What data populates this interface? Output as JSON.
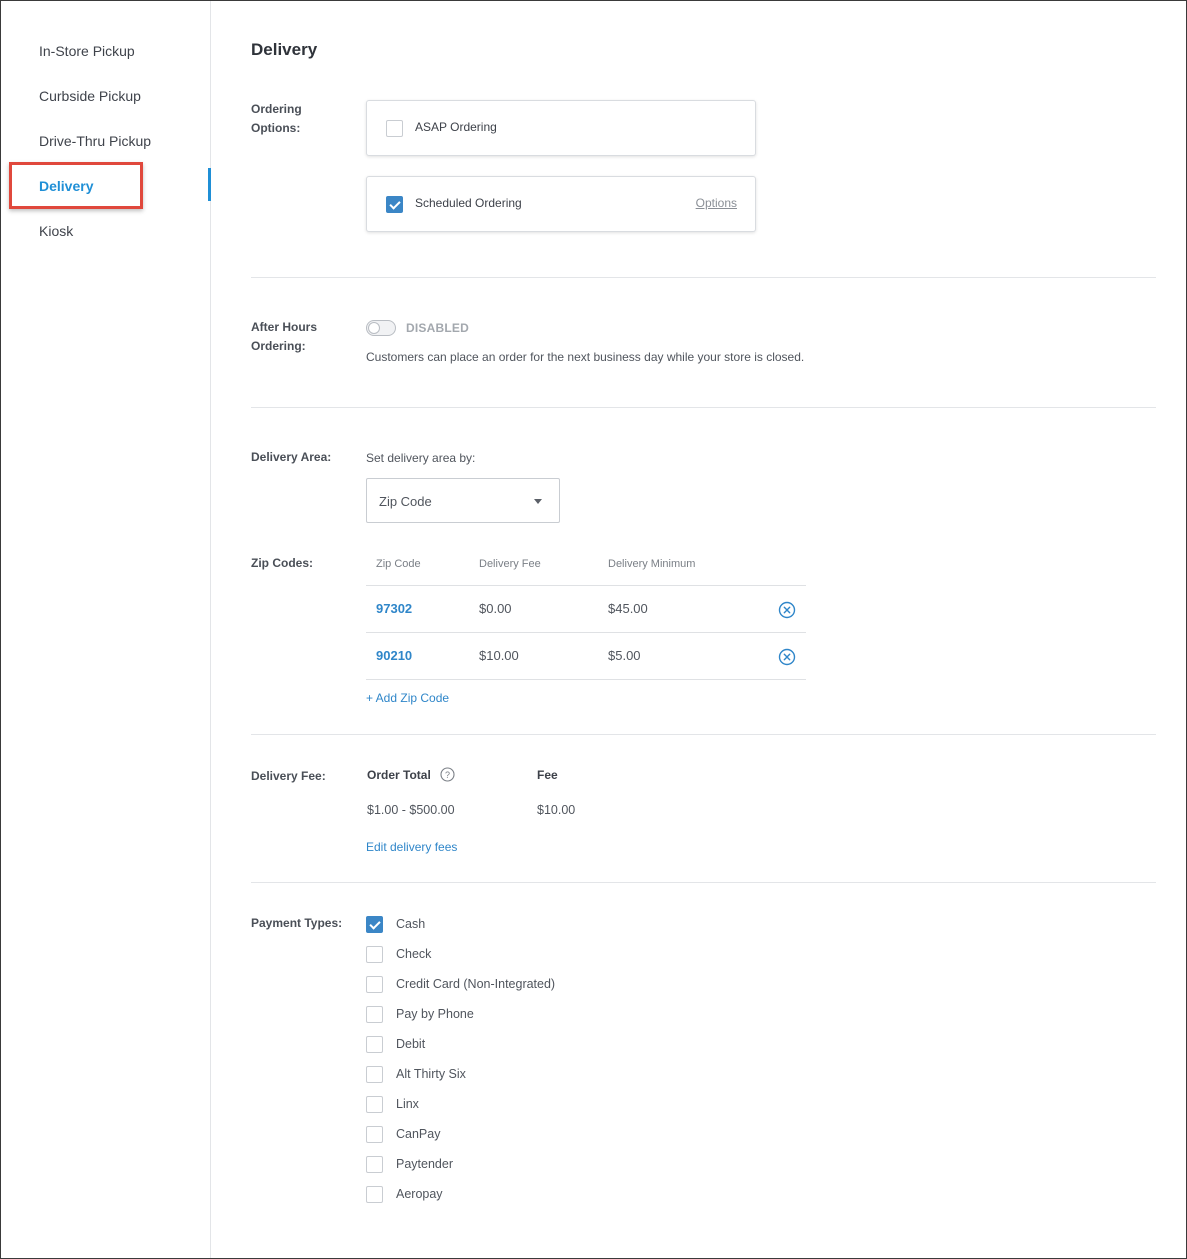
{
  "sidebar": {
    "items": [
      {
        "label": "In-Store Pickup",
        "active": false
      },
      {
        "label": "Curbside Pickup",
        "active": false
      },
      {
        "label": "Drive-Thru Pickup",
        "active": false
      },
      {
        "label": "Delivery",
        "active": true
      },
      {
        "label": "Kiosk",
        "active": false
      }
    ]
  },
  "page": {
    "title": "Delivery"
  },
  "ordering_options": {
    "label": "Ordering Options:",
    "asap": {
      "label": "ASAP Ordering",
      "checked": false
    },
    "scheduled": {
      "label": "Scheduled Ordering",
      "checked": true,
      "options_link": "Options"
    }
  },
  "after_hours": {
    "label": "After Hours Ordering:",
    "toggle_state": "DISABLED",
    "enabled": false,
    "help": "Customers can place an order for the next business day while your store is closed."
  },
  "delivery_area": {
    "label": "Delivery Area:",
    "set_by": "Set delivery area by:",
    "selected": "Zip Code"
  },
  "zip_codes": {
    "label": "Zip Codes:",
    "columns": [
      "Zip Code",
      "Delivery Fee",
      "Delivery Minimum"
    ],
    "rows": [
      {
        "zip": "97302",
        "fee": "$0.00",
        "minimum": "$45.00"
      },
      {
        "zip": "90210",
        "fee": "$10.00",
        "minimum": "$5.00"
      }
    ],
    "add_link": "+ Add Zip Code"
  },
  "delivery_fee": {
    "label": "Delivery Fee:",
    "order_total_header": "Order Total",
    "fee_header": "Fee",
    "range": "$1.00 - $500.00",
    "fee": "$10.00",
    "edit_link": "Edit delivery fees"
  },
  "payment_types": {
    "label": "Payment Types:",
    "items": [
      {
        "label": "Cash",
        "checked": true
      },
      {
        "label": "Check",
        "checked": false
      },
      {
        "label": "Credit Card (Non-Integrated)",
        "checked": false
      },
      {
        "label": "Pay by Phone",
        "checked": false
      },
      {
        "label": "Debit",
        "checked": false
      },
      {
        "label": "Alt Thirty Six",
        "checked": false
      },
      {
        "label": "Linx",
        "checked": false
      },
      {
        "label": "CanPay",
        "checked": false
      },
      {
        "label": "Paytender",
        "checked": false
      },
      {
        "label": "Aeropay",
        "checked": false
      }
    ]
  },
  "colors": {
    "accent": "#1f8fd6",
    "highlight": "#e0483c",
    "checkbox": "#3b86c6"
  }
}
